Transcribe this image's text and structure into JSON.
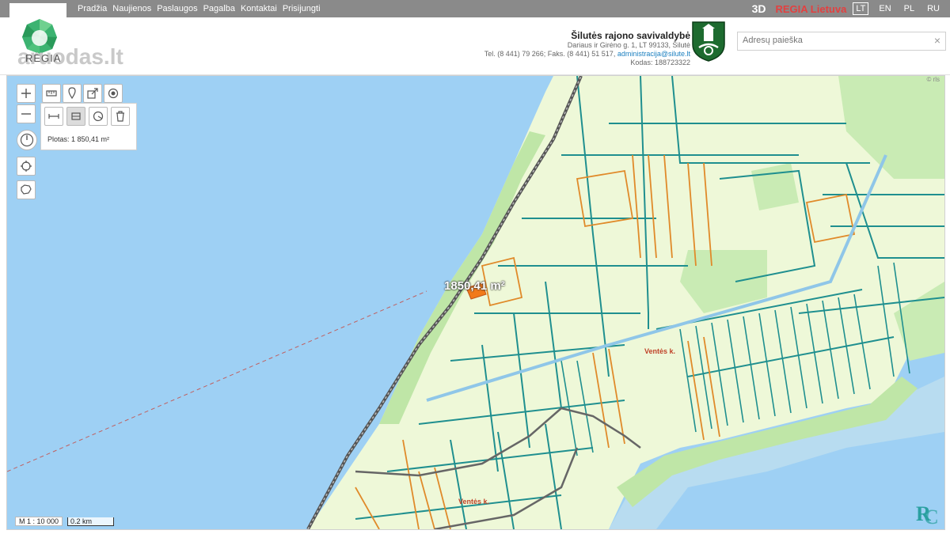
{
  "top_nav": {
    "items": [
      "Pradžia",
      "Naujienos",
      "Paslaugos",
      "Pagalba",
      "Kontaktai",
      "Prisijungti"
    ],
    "three_d": "3D",
    "regia_lietuva": "REGIA Lietuva",
    "languages": [
      "LT",
      "EN",
      "PL",
      "RU"
    ],
    "active_language": "LT"
  },
  "header": {
    "logo_text": "REGIA",
    "watermark": "aruodas.lt",
    "municipality": "Šilutės rajono savivaldybė",
    "address": "Dariaus ir Girėno g. 1, LT 99133, Šilutė",
    "phone_prefix": "Tel. (8 441) 79 266; Faks. (8 441) 51 517, ",
    "email": "administracija@silute.lt",
    "code": "Kodas: 188723322"
  },
  "search": {
    "placeholder": "Adresų paieška",
    "clear": "×"
  },
  "map": {
    "area_result": "Plotas: 1 850,41 m²",
    "measure_label": "1850,41 m²",
    "place_labels": [
      "Ventės k.",
      "Ventės k."
    ],
    "scale_ratio": "M 1 : 10 000",
    "scale_bar": "0.2 km",
    "attribution": "© rls"
  },
  "colors": {
    "water": "#9ed0f4",
    "land": "#f0fadc",
    "parcel_teal": "#1f8f8f",
    "parcel_orange": "#e08a2a",
    "road": "#555555",
    "accent_red": "#e34040"
  }
}
